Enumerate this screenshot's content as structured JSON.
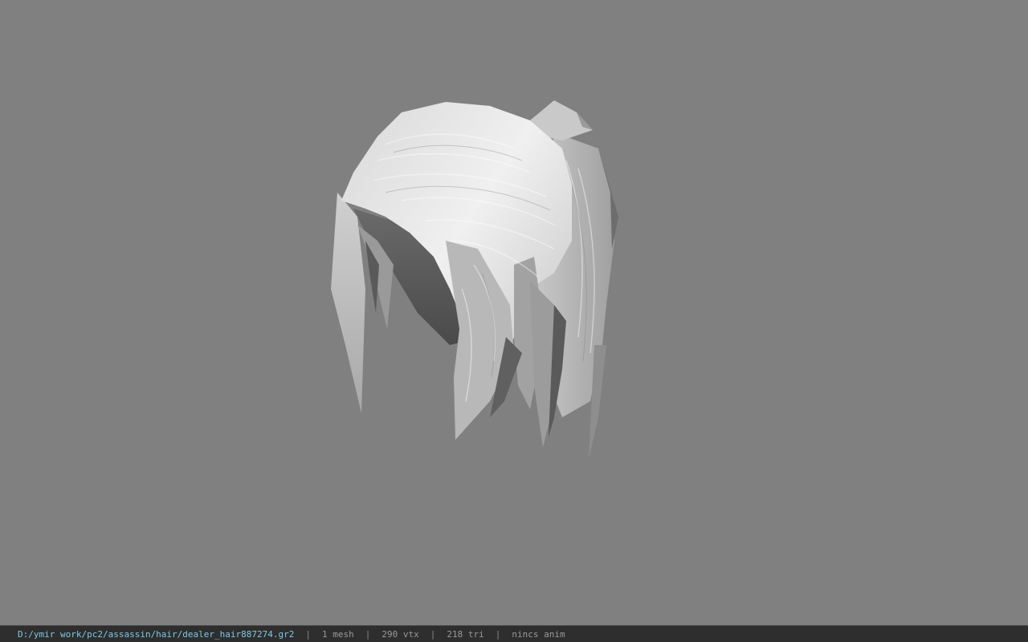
{
  "viewer": {
    "background_color": "#808080",
    "model_icon": "hair-mesh-model"
  },
  "status": {
    "file_path": "D:/ymir work/pc2/assassin/hair/dealer_hair887274.gr2",
    "separator": "|",
    "mesh_count": "1 mesh",
    "vertex_count": "290 vtx",
    "triangle_count": "218 tri",
    "animation": "nincs anim",
    "path_color": "#7ec8e3"
  }
}
